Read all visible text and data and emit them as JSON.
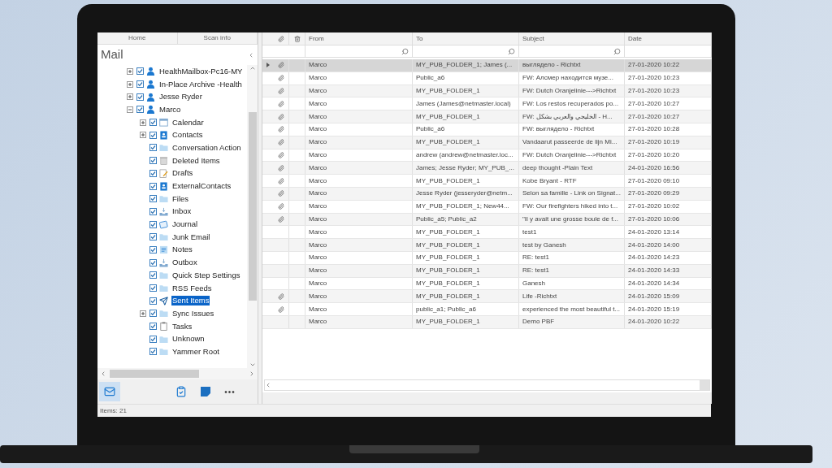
{
  "ribbon_tabs": [
    {
      "label": "Home"
    },
    {
      "label": "Scan info"
    }
  ],
  "pane_title": "Mail",
  "tree": [
    {
      "label": "HealthMailbox-Pc16-MY",
      "kind": "account",
      "checked": true,
      "selected": false,
      "expanded": false
    },
    {
      "label": "In-Place Archive -Health",
      "kind": "account",
      "checked": true,
      "selected": false,
      "expanded": false
    },
    {
      "label": "Jesse Ryder",
      "kind": "account",
      "checked": true,
      "selected": false,
      "expanded": false
    },
    {
      "label": "Marco",
      "kind": "account",
      "checked": true,
      "selected": false,
      "expanded": true,
      "children": [
        {
          "label": "Calendar",
          "kind": "calendar",
          "checked": true,
          "selected": false,
          "expanded": false
        },
        {
          "label": "Contacts",
          "kind": "contacts",
          "checked": true,
          "selected": false,
          "expanded": false
        },
        {
          "label": "Conversation Action",
          "kind": "folder",
          "checked": true,
          "selected": false
        },
        {
          "label": "Deleted Items",
          "kind": "trash",
          "checked": true,
          "selected": false
        },
        {
          "label": "Drafts",
          "kind": "drafts",
          "checked": true,
          "selected": false
        },
        {
          "label": "ExternalContacts",
          "kind": "contacts",
          "checked": true,
          "selected": false
        },
        {
          "label": "Files",
          "kind": "folder",
          "checked": true,
          "selected": false
        },
        {
          "label": "Inbox",
          "kind": "tray",
          "checked": true,
          "selected": false
        },
        {
          "label": "Journal",
          "kind": "journal",
          "checked": true,
          "selected": false
        },
        {
          "label": "Junk Email",
          "kind": "folder",
          "checked": true,
          "selected": false
        },
        {
          "label": "Notes",
          "kind": "notes",
          "checked": true,
          "selected": false
        },
        {
          "label": "Outbox",
          "kind": "tray",
          "checked": true,
          "selected": false
        },
        {
          "label": "Quick Step Settings",
          "kind": "folder",
          "checked": true,
          "selected": false
        },
        {
          "label": "RSS Feeds",
          "kind": "folder",
          "checked": true,
          "selected": false
        },
        {
          "label": "Sent Items",
          "kind": "sent",
          "checked": true,
          "selected": true
        },
        {
          "label": "Sync Issues",
          "kind": "folder",
          "checked": true,
          "selected": false,
          "expanded": false
        },
        {
          "label": "Tasks",
          "kind": "tasks",
          "checked": true,
          "selected": false
        },
        {
          "label": "Unknown",
          "kind": "folder",
          "checked": true,
          "selected": false
        },
        {
          "label": "Yammer Root",
          "kind": "folder",
          "checked": true,
          "selected": false
        }
      ]
    }
  ],
  "nav": [
    {
      "kind": "mail",
      "selected": true
    },
    {
      "kind": "tasks",
      "selected": false
    },
    {
      "kind": "notes",
      "selected": false
    },
    {
      "kind": "more",
      "label": "•••",
      "selected": false
    }
  ],
  "status_bar": "Items: 21",
  "table": {
    "columns": [
      "From",
      "To",
      "Subject",
      "Date"
    ],
    "rows": [
      {
        "attachment": true,
        "selected": true,
        "from": "Marco",
        "to": "MY_PUB_FOLDER_1; James (...",
        "subject": "выглядело  - Richtxt",
        "date": "27-01-2020 10:22"
      },
      {
        "attachment": true,
        "selected": false,
        "from": "Marco",
        "to": "Public_a6",
        "subject": "FW: Алсмер находится музе...",
        "date": "27-01-2020 10:23"
      },
      {
        "attachment": true,
        "selected": false,
        "from": "Marco",
        "to": "MY_PUB_FOLDER_1",
        "subject": "FW: Dutch Oranjelinie--->Richtxt",
        "date": "27-01-2020 10:23"
      },
      {
        "attachment": true,
        "selected": false,
        "from": "Marco",
        "to": "James (James@netmaster.local)",
        "subject": "FW: Los restos recuperados po...",
        "date": "27-01-2020 10:27"
      },
      {
        "attachment": true,
        "selected": false,
        "from": "Marco",
        "to": "MY_PUB_FOLDER_1",
        "subject": "FW: الخليجي والعربي بشكل - H...",
        "date": "27-01-2020 10:27"
      },
      {
        "attachment": true,
        "selected": false,
        "from": "Marco",
        "to": "Public_a6",
        "subject": "FW: выглядело  - Richtxt",
        "date": "27-01-2020 10:28"
      },
      {
        "attachment": true,
        "selected": false,
        "from": "Marco",
        "to": "MY_PUB_FOLDER_1",
        "subject": "Vandaarut passeerde de lijn Mi...",
        "date": "27-01-2020 10:19"
      },
      {
        "attachment": true,
        "selected": false,
        "from": "Marco",
        "to": "andrew (andrew@netmaster.loc...",
        "subject": "FW: Dutch Oranjelinie--->Richtxt",
        "date": "27-01-2020 10:20"
      },
      {
        "attachment": true,
        "selected": false,
        "from": "Marco",
        "to": "James; Jesse Ryder; MY_PUB_...",
        "subject": "deep thought -Plain Text",
        "date": "24-01-2020 16:56"
      },
      {
        "attachment": true,
        "selected": false,
        "from": "Marco",
        "to": "MY_PUB_FOLDER_1",
        "subject": "Kobe Bryant - RTF",
        "date": "27-01-2020 09:10"
      },
      {
        "attachment": true,
        "selected": false,
        "from": "Marco",
        "to": "Jesse Ryder (jesseryder@netm...",
        "subject": "Selon sa famille - Link on Signat...",
        "date": "27-01-2020 09:29"
      },
      {
        "attachment": true,
        "selected": false,
        "from": "Marco",
        "to": "MY_PUB_FOLDER_1; New44...",
        "subject": "FW: Our firefighters hiked into t...",
        "date": "27-01-2020 10:02"
      },
      {
        "attachment": true,
        "selected": false,
        "from": "Marco",
        "to": "Public_a5; Public_a2",
        "subject": "\"Il y avait une grosse boule de f...",
        "date": "27-01-2020 10:06"
      },
      {
        "attachment": false,
        "selected": false,
        "from": "Marco",
        "to": "MY_PUB_FOLDER_1",
        "subject": "test1",
        "date": "24-01-2020 13:14"
      },
      {
        "attachment": false,
        "selected": false,
        "from": "Marco",
        "to": "MY_PUB_FOLDER_1",
        "subject": "test by Ganesh",
        "date": "24-01-2020 14:00"
      },
      {
        "attachment": false,
        "selected": false,
        "from": "Marco",
        "to": "MY_PUB_FOLDER_1",
        "subject": "RE: test1",
        "date": "24-01-2020 14:23"
      },
      {
        "attachment": false,
        "selected": false,
        "from": "Marco",
        "to": "MY_PUB_FOLDER_1",
        "subject": "RE: test1",
        "date": "24-01-2020 14:33"
      },
      {
        "attachment": false,
        "selected": false,
        "from": "Marco",
        "to": "MY_PUB_FOLDER_1",
        "subject": "Ganesh",
        "date": "24-01-2020 14:34"
      },
      {
        "attachment": true,
        "selected": false,
        "from": "Marco",
        "to": "MY_PUB_FOLDER_1",
        "subject": "Life -Richtxt",
        "date": "24-01-2020 15:09"
      },
      {
        "attachment": true,
        "selected": false,
        "from": "Marco",
        "to": "public_a1; Public_a6",
        "subject": "experienced the most beautiful t...",
        "date": "24-01-2020 15:19"
      },
      {
        "attachment": false,
        "selected": false,
        "from": "Marco",
        "to": "MY_PUB_FOLDER_1",
        "subject": "Demo PBF",
        "date": "24-01-2020 10:22"
      }
    ]
  }
}
